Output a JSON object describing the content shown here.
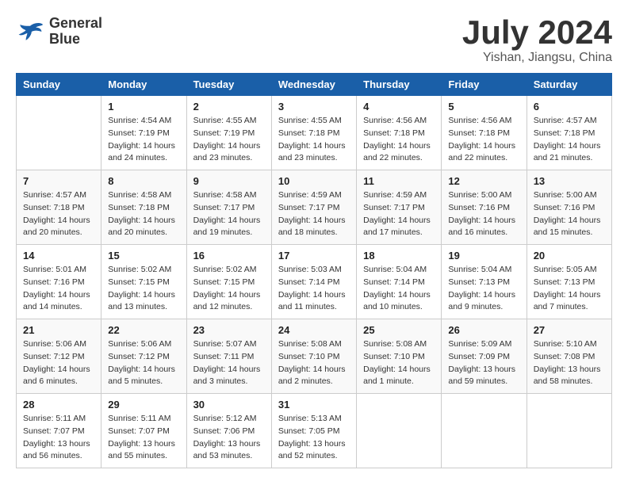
{
  "logo": {
    "line1": "General",
    "line2": "Blue"
  },
  "title": "July 2024",
  "location": "Yishan, Jiangsu, China",
  "days_of_week": [
    "Sunday",
    "Monday",
    "Tuesday",
    "Wednesday",
    "Thursday",
    "Friday",
    "Saturday"
  ],
  "weeks": [
    [
      {
        "day": "",
        "info": ""
      },
      {
        "day": "1",
        "info": "Sunrise: 4:54 AM\nSunset: 7:19 PM\nDaylight: 14 hours\nand 24 minutes."
      },
      {
        "day": "2",
        "info": "Sunrise: 4:55 AM\nSunset: 7:19 PM\nDaylight: 14 hours\nand 23 minutes."
      },
      {
        "day": "3",
        "info": "Sunrise: 4:55 AM\nSunset: 7:18 PM\nDaylight: 14 hours\nand 23 minutes."
      },
      {
        "day": "4",
        "info": "Sunrise: 4:56 AM\nSunset: 7:18 PM\nDaylight: 14 hours\nand 22 minutes."
      },
      {
        "day": "5",
        "info": "Sunrise: 4:56 AM\nSunset: 7:18 PM\nDaylight: 14 hours\nand 22 minutes."
      },
      {
        "day": "6",
        "info": "Sunrise: 4:57 AM\nSunset: 7:18 PM\nDaylight: 14 hours\nand 21 minutes."
      }
    ],
    [
      {
        "day": "7",
        "info": "Sunrise: 4:57 AM\nSunset: 7:18 PM\nDaylight: 14 hours\nand 20 minutes."
      },
      {
        "day": "8",
        "info": "Sunrise: 4:58 AM\nSunset: 7:18 PM\nDaylight: 14 hours\nand 20 minutes."
      },
      {
        "day": "9",
        "info": "Sunrise: 4:58 AM\nSunset: 7:17 PM\nDaylight: 14 hours\nand 19 minutes."
      },
      {
        "day": "10",
        "info": "Sunrise: 4:59 AM\nSunset: 7:17 PM\nDaylight: 14 hours\nand 18 minutes."
      },
      {
        "day": "11",
        "info": "Sunrise: 4:59 AM\nSunset: 7:17 PM\nDaylight: 14 hours\nand 17 minutes."
      },
      {
        "day": "12",
        "info": "Sunrise: 5:00 AM\nSunset: 7:16 PM\nDaylight: 14 hours\nand 16 minutes."
      },
      {
        "day": "13",
        "info": "Sunrise: 5:00 AM\nSunset: 7:16 PM\nDaylight: 14 hours\nand 15 minutes."
      }
    ],
    [
      {
        "day": "14",
        "info": "Sunrise: 5:01 AM\nSunset: 7:16 PM\nDaylight: 14 hours\nand 14 minutes."
      },
      {
        "day": "15",
        "info": "Sunrise: 5:02 AM\nSunset: 7:15 PM\nDaylight: 14 hours\nand 13 minutes."
      },
      {
        "day": "16",
        "info": "Sunrise: 5:02 AM\nSunset: 7:15 PM\nDaylight: 14 hours\nand 12 minutes."
      },
      {
        "day": "17",
        "info": "Sunrise: 5:03 AM\nSunset: 7:14 PM\nDaylight: 14 hours\nand 11 minutes."
      },
      {
        "day": "18",
        "info": "Sunrise: 5:04 AM\nSunset: 7:14 PM\nDaylight: 14 hours\nand 10 minutes."
      },
      {
        "day": "19",
        "info": "Sunrise: 5:04 AM\nSunset: 7:13 PM\nDaylight: 14 hours\nand 9 minutes."
      },
      {
        "day": "20",
        "info": "Sunrise: 5:05 AM\nSunset: 7:13 PM\nDaylight: 14 hours\nand 7 minutes."
      }
    ],
    [
      {
        "day": "21",
        "info": "Sunrise: 5:06 AM\nSunset: 7:12 PM\nDaylight: 14 hours\nand 6 minutes."
      },
      {
        "day": "22",
        "info": "Sunrise: 5:06 AM\nSunset: 7:12 PM\nDaylight: 14 hours\nand 5 minutes."
      },
      {
        "day": "23",
        "info": "Sunrise: 5:07 AM\nSunset: 7:11 PM\nDaylight: 14 hours\nand 3 minutes."
      },
      {
        "day": "24",
        "info": "Sunrise: 5:08 AM\nSunset: 7:10 PM\nDaylight: 14 hours\nand 2 minutes."
      },
      {
        "day": "25",
        "info": "Sunrise: 5:08 AM\nSunset: 7:10 PM\nDaylight: 14 hours\nand 1 minute."
      },
      {
        "day": "26",
        "info": "Sunrise: 5:09 AM\nSunset: 7:09 PM\nDaylight: 13 hours\nand 59 minutes."
      },
      {
        "day": "27",
        "info": "Sunrise: 5:10 AM\nSunset: 7:08 PM\nDaylight: 13 hours\nand 58 minutes."
      }
    ],
    [
      {
        "day": "28",
        "info": "Sunrise: 5:11 AM\nSunset: 7:07 PM\nDaylight: 13 hours\nand 56 minutes."
      },
      {
        "day": "29",
        "info": "Sunrise: 5:11 AM\nSunset: 7:07 PM\nDaylight: 13 hours\nand 55 minutes."
      },
      {
        "day": "30",
        "info": "Sunrise: 5:12 AM\nSunset: 7:06 PM\nDaylight: 13 hours\nand 53 minutes."
      },
      {
        "day": "31",
        "info": "Sunrise: 5:13 AM\nSunset: 7:05 PM\nDaylight: 13 hours\nand 52 minutes."
      },
      {
        "day": "",
        "info": ""
      },
      {
        "day": "",
        "info": ""
      },
      {
        "day": "",
        "info": ""
      }
    ]
  ]
}
